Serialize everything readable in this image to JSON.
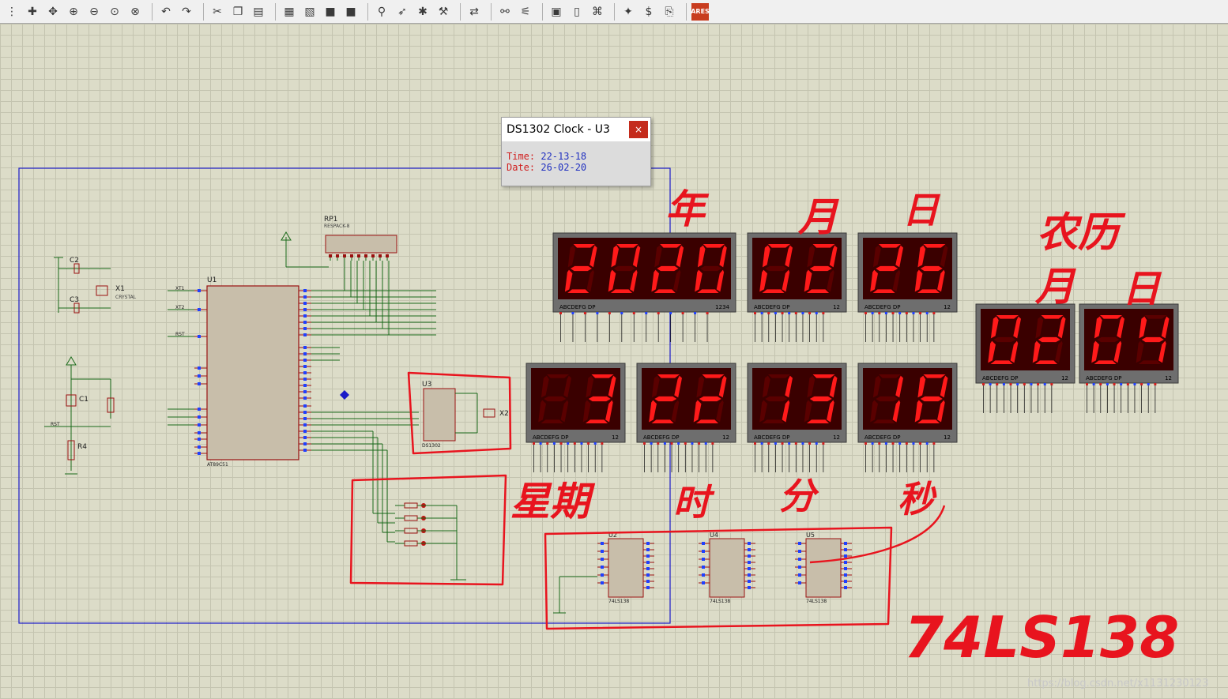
{
  "toolbar": {
    "icons": [
      "grid-icon",
      "origin-icon",
      "pan-icon",
      "zoom-in-icon",
      "zoom-out-icon",
      "zoom-all-icon",
      "zoom-area-icon",
      "undo-icon",
      "redo-icon",
      "cut-icon",
      "copy-icon",
      "paste-icon",
      "block-copy-icon",
      "block-move-icon",
      "block-rotate-icon",
      "block-delete-icon",
      "pick-device-icon",
      "make-device-icon",
      "package-tool-icon",
      "decompose-icon",
      "wire-autorouter-icon",
      "search-tag-icon",
      "property-assign-icon",
      "new-sheet-icon",
      "remove-sheet-icon",
      "goto-sheet-icon",
      "bill-of-materials-icon",
      "electrical-rule-check-icon",
      "netlist-icon",
      "ares-icon"
    ],
    "ares_label": "ARES"
  },
  "popup": {
    "title": "DS1302 Clock - U3",
    "close_glyph": "×",
    "time_label": "Time:",
    "time_value": "22-13-18",
    "date_label": "Date:",
    "date_value": "26-02-20"
  },
  "displays": {
    "year": "2020",
    "month": "02",
    "day": "26",
    "weekday": " 3",
    "hour": "22",
    "minute": "13",
    "second": "18",
    "lunar_month": "02",
    "lunar_day": "04",
    "pin_label_4": "ABCDEFG  DP",
    "pin_label_4_num": "1234",
    "pin_label_2_num": "12"
  },
  "schematic": {
    "rp1": "RP1",
    "rp1_sub": "RESPACK-8",
    "c2": "C2",
    "c3": "C3",
    "x1": "X1",
    "crystal": "CRYSTAL",
    "u1": "U1",
    "u1_part": "AT89C51",
    "u3": "U3",
    "u3_part": "DS1302",
    "x2": "X2",
    "c1": "C1",
    "r4": "R4",
    "rst": "RST",
    "xt1": "XT1",
    "xt2": "XT2",
    "u2": "U2",
    "u4": "U4",
    "u5": "U5",
    "part_74ls138": "74LS138",
    "text_placeholder": "<TEXT>"
  },
  "annotations": {
    "year": "年",
    "month": "月",
    "day": "日",
    "lunar": "农历",
    "lunar_month": "月",
    "lunar_day": "日",
    "weekday": "星期",
    "hour": "时",
    "minute": "分",
    "second": "秒",
    "decoder": "74LS138"
  },
  "watermark": "https://blog.csdn.net/x1131230123",
  "colors": {
    "background": "#dcdcc8",
    "segment_on": "#ff1a1a",
    "segment_off": "#5a0000",
    "display_bezel": "#6e6e6e",
    "annotation_red": "#e8141e",
    "frame_blue": "#1a1ac8",
    "chip_fill": "#c8beaa",
    "chip_border": "#7a1010",
    "wire": "#1a6a1a"
  }
}
